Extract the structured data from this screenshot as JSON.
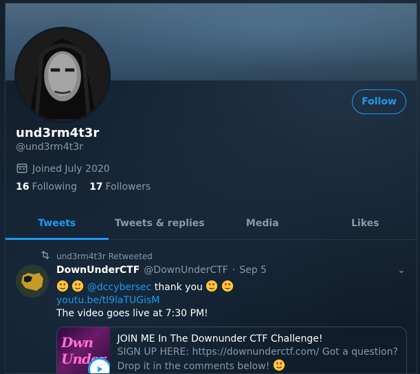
{
  "profile": {
    "display_name": "und3rm4t3r",
    "handle": "@und3rm4t3r",
    "joined": "Joined July 2020",
    "follow_label": "Follow",
    "following_count": "16",
    "following_label": "Following",
    "followers_count": "17",
    "followers_label": "Followers"
  },
  "tabs": [
    {
      "label": "Tweets",
      "active": true
    },
    {
      "label": "Tweets & replies",
      "active": false
    },
    {
      "label": "Media",
      "active": false
    },
    {
      "label": "Likes",
      "active": false
    }
  ],
  "tweet": {
    "retweet_note": "und3rm4t3r Retweeted",
    "author": "DownUnderCTF",
    "author_handle": "@DownUnderCTF",
    "separator": "·",
    "date": "Sep 5",
    "mention": "@dccybersec",
    "thank_text": "thank you",
    "link": "youtu.be/tl9laTUGisM",
    "line3": "The video goes live at 7:30 PM!",
    "card_title": "JOIN ME In The Downunder CTF Challenge!",
    "card_desc": "SIGN UP HERE: https://downunderctf.com/ Got a question? Drop it in the comments below!",
    "thumb_text": "Dwn Under"
  },
  "colors": {
    "accent": "#1d9bf0",
    "muted": "#8b98a5",
    "background": "#0e1a26"
  },
  "icons": {
    "calendar": "calendar-icon",
    "retweet": "retweet-icon",
    "caret": "chevron-down-icon",
    "play": "play-icon",
    "emoji": "heart-eyes-emoji"
  }
}
